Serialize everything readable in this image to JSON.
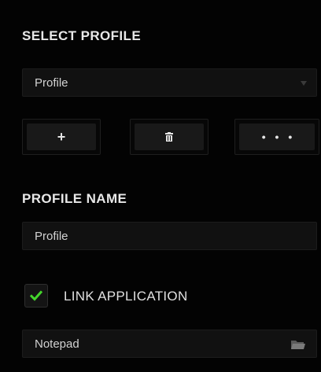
{
  "select_profile": {
    "title": "SELECT PROFILE",
    "dropdown_value": "Profile",
    "dropdown_icon": "chevron-down-icon",
    "actions": [
      {
        "name": "add",
        "glyph": "+",
        "icon": "plus-icon"
      },
      {
        "name": "delete",
        "glyph": "",
        "icon": "trash-icon"
      },
      {
        "name": "more",
        "glyph": "• • •",
        "icon": "more-options-icon"
      }
    ]
  },
  "profile_name": {
    "title": "PROFILE NAME",
    "value": "Profile"
  },
  "link_application": {
    "checked": true,
    "label": "LINK APPLICATION",
    "app_value": "Notepad",
    "browse_icon": "folder-icon"
  },
  "colors": {
    "background": "#030303",
    "field": "#111111",
    "check_accent": "#44d62c",
    "text": "#d2d2d2"
  }
}
